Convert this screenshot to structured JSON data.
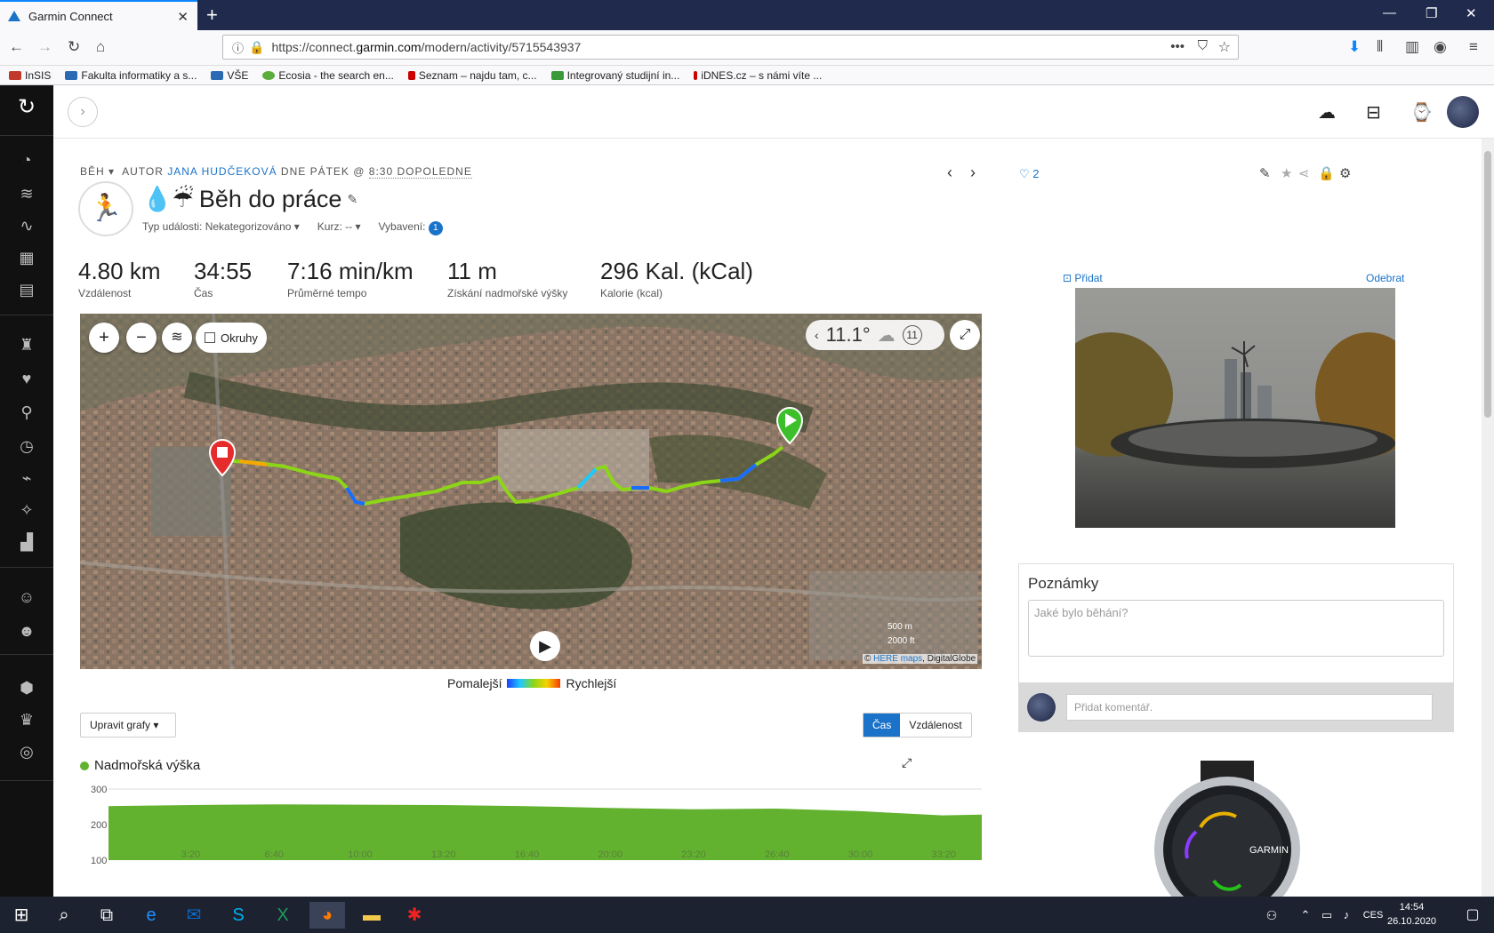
{
  "browser": {
    "tab_title": "Garmin Connect",
    "url_prefix": "https://connect.",
    "url_domain": "garmin.com",
    "url_path": "/modern/activity/5715543937",
    "bookmarks": [
      {
        "label": "InSIS",
        "color": "#c0392b"
      },
      {
        "label": "Fakulta informatiky a s...",
        "color": "#2a6ab5"
      },
      {
        "label": "VŠE",
        "color": "#2a6ab5"
      },
      {
        "label": "Ecosia - the search en...",
        "color": "#5bae3b"
      },
      {
        "label": "Seznam – najdu tam, c...",
        "color": "#cc0000"
      },
      {
        "label": "Integrovaný studijní in...",
        "color": "#3a9a3a"
      },
      {
        "label": "iDNES.cz – s námi víte ...",
        "color": "#cc0000"
      }
    ]
  },
  "activity": {
    "meta_type": "BĚH",
    "meta_author_prefix": "AUTOR",
    "meta_author": "JANA HUDČEKOVÁ",
    "meta_day": "DNE PÁTEK @",
    "meta_time": "8:30 DOPOLEDNE",
    "title": "Běh do práce",
    "title_emoji": "💧☔",
    "event_type": "Typ události: Nekategorizováno",
    "course": "Kurz: --",
    "gear": "Vybavení:",
    "gear_count": "1",
    "likes": "2"
  },
  "stats": [
    {
      "value": "4.80 km",
      "label": "Vzdálenost"
    },
    {
      "value": "34:55",
      "label": "Čas"
    },
    {
      "value": "7:16 min/km",
      "label": "Průměrné tempo"
    },
    {
      "value": "11 m",
      "label": "Získání nadmořské výšky"
    },
    {
      "value": "296 Kal. (kCal)",
      "label": "Kalorie (kcal)"
    }
  ],
  "map": {
    "laps_label": "Okruhy",
    "temperature": "11.1°",
    "wind": "11",
    "scale_m": "500 m",
    "scale_ft": "2000 ft",
    "credits_prefix": "©",
    "credits_here": "HERE maps",
    "credits_dg": "DigitalGlobe"
  },
  "legend": {
    "slower": "Pomalejší",
    "faster": "Rychlejší"
  },
  "charts_controls": {
    "edit_label": "Upravit grafy ▾",
    "time_label": "Čas",
    "distance_label": "Vzdálenost"
  },
  "chart_data": {
    "type": "area",
    "title": "Nadmořská výška",
    "xlabel": "",
    "ylabel": "",
    "ylim": [
      100,
      300
    ],
    "y_ticks": [
      "300",
      "200",
      "100"
    ],
    "x_ticks": [
      "3:20",
      "6:40",
      "10:00",
      "13:20",
      "16:40",
      "20:00",
      "23:20",
      "26:40",
      "30:00",
      "33:20"
    ],
    "x": [
      0,
      200,
      400,
      600,
      800,
      1000,
      1200,
      1400,
      1600,
      1800,
      1900,
      2000,
      2095
    ],
    "values": [
      252,
      255,
      257,
      256,
      255,
      252,
      247,
      243,
      245,
      238,
      232,
      226,
      228
    ],
    "color": "#62b22f"
  },
  "sidebar_right": {
    "add_photo": "Přidat",
    "remove_photo": "Odebrat",
    "notes_title": "Poznámky",
    "notes_placeholder": "Jaké bylo běhání?",
    "comment_placeholder": "Přidat komentář."
  },
  "watch": {
    "brand": "GARMIN"
  },
  "taskbar": {
    "lang": "CES",
    "time": "14:54",
    "date": "26.10.2020"
  }
}
